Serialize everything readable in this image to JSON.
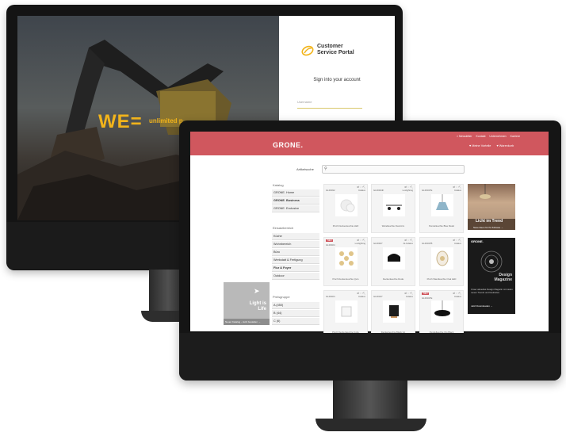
{
  "back_screen": {
    "hero_text": "WE=",
    "hero_tagline": "unlimited p",
    "portal_title_line1": "Customer",
    "portal_title_line2": "Service Portal",
    "portal_subtitle": "Sign into your account",
    "username_placeholder": "Username"
  },
  "front_screen": {
    "header": {
      "logo": "GRONE.",
      "top_links": [
        "> Newsletter",
        "Kontakt",
        "Unternehmen",
        "Karriere"
      ],
      "account_links": [
        "♥ Meine Vorteile",
        "♥ Warenkorb"
      ]
    },
    "search": {
      "label": "Artikelsuche"
    },
    "sidebar": {
      "catalog_heading": "Katalog",
      "catalog_items": [
        "GRONE. Home",
        "GRONE. Business",
        "GRONE. Exclusive"
      ],
      "area_heading": "Einsatzbereich",
      "area_items": [
        "Küche",
        "Wohnbereich",
        "Büro",
        "Werkstatt & Fertigung",
        "Flur & Foyer",
        "Outdoor"
      ],
      "price_heading": "Preisgruppe",
      "price_items": [
        "A (450)",
        "B (44)",
        "C (6)"
      ]
    },
    "promo_left": {
      "title_line1": "Light is",
      "title_line2": "Life",
      "footer": "Neuer Katalog - Jetzt bestellen →"
    },
    "products": [
      {
        "code": "GL00492",
        "brand": "Indalux",
        "name": "Pinch Deckenleuchte LED",
        "badge": ""
      },
      {
        "code": "GL00404F",
        "brand": "Luxlighting",
        "name": "Wandleuchte Dual Arm",
        "badge": ""
      },
      {
        "code": "GL00347E",
        "brand": "Indalux",
        "name": "Pendelleuchte Blue Metal",
        "badge": ""
      },
      {
        "code": "GL00404",
        "brand": "Luxlighting",
        "name": "Pinch Deckenleuchte Quin",
        "badge": "NEU"
      },
      {
        "code": "GL00407",
        "brand": "Al-Indalux",
        "name": "Deckenleuchte Roda",
        "badge": ""
      },
      {
        "code": "GL00347B",
        "brand": "Indalux",
        "name": "Pinch Wandleuchte Oval LED",
        "badge": ""
      },
      {
        "code": "GL00404",
        "brand": "Indalux",
        "name": "Pinch Deckenleuchte Cube",
        "badge": ""
      },
      {
        "code": "GL00347",
        "brand": "Indalux",
        "name": "Deckenleuchte Black Up",
        "badge": ""
      },
      {
        "code": "GL00347E",
        "brand": "Indalux",
        "name": "Pendelleuchte Ufo Black",
        "badge": "NEU"
      }
    ],
    "promo_trend": {
      "title": "Licht im Trend",
      "subtitle": "Neue Ideen für Ihr Zuhause →"
    },
    "promo_magazine": {
      "brand": "GRONE.",
      "title": "Design Magazine",
      "text": "Unser aktuelles Design Magazin mit vielen neuen Trends und Neuheiten.",
      "button": "Jetzt Downloaden →"
    }
  },
  "colors": {
    "brand_red": "#d0575e",
    "accent_yellow": "#f2b41b"
  }
}
